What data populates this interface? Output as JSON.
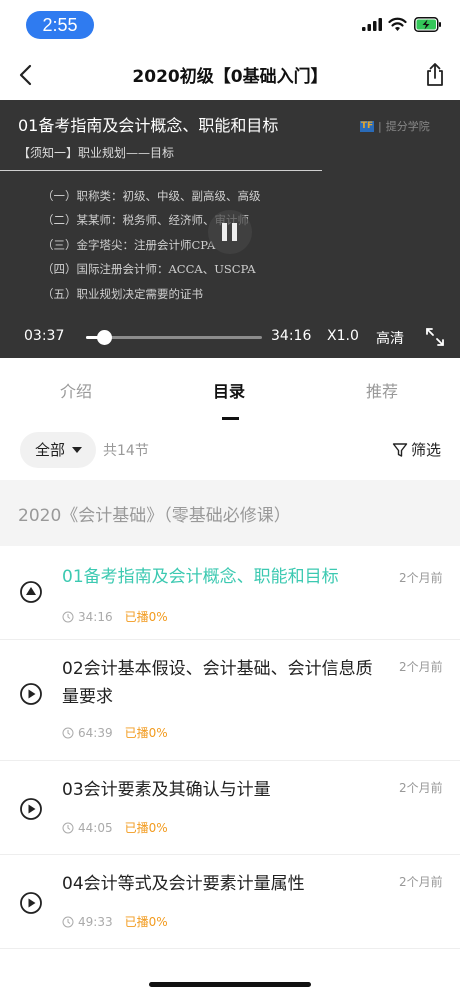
{
  "status_bar": {
    "time": "2:55"
  },
  "nav": {
    "title": "2020初级【0基础入门】"
  },
  "video": {
    "title": "01备考指南及会计概念、职能和目标",
    "brand": "提分学院",
    "brand_mark": "TF",
    "subtitle": "【须知一】职业规划——目标",
    "outline": [
      "（一）职称类：初级、中级、副高级、高级",
      "（二）某某师：税务师、经济师、审计师",
      "（三）金字塔尖：注册会计师CPA",
      "（四）国际注册会计师：ACCA、USCPA",
      "（五）职业规划决定需要的证书"
    ],
    "current_time": "03:37",
    "total_time": "34:16",
    "progress": 0.1055,
    "speed": "X1.0",
    "quality": "高清"
  },
  "tabs": [
    {
      "label": "介绍",
      "active": false
    },
    {
      "label": "目录",
      "active": true
    },
    {
      "label": "推荐",
      "active": false
    }
  ],
  "filter": {
    "scope_label": "全部",
    "count_text": "共14节",
    "filter_label": "筛选"
  },
  "section": {
    "title": "2020《会计基础》（零基础必修课）"
  },
  "lessons": [
    {
      "title": "01备考指南及会计概念、职能和目标",
      "date": "2个月前",
      "duration": "34:16",
      "progress": "已播0%",
      "active": true
    },
    {
      "title": "02会计基本假设、会计基础、会计信息质量要求",
      "date": "2个月前",
      "duration": "64:39",
      "progress": "已播0%",
      "active": false
    },
    {
      "title": "03会计要素及其确认与计量",
      "date": "2个月前",
      "duration": "44:05",
      "progress": "已播0%",
      "active": false
    },
    {
      "title": "04会计等式及会计要素计量属性",
      "date": "2个月前",
      "duration": "49:33",
      "progress": "已播0%",
      "active": false
    }
  ],
  "icons": {
    "status": [
      "signal-icon",
      "wifi-icon",
      "battery-charging-icon"
    ],
    "nav": [
      "back-icon",
      "share-icon"
    ],
    "player": [
      "pause-icon",
      "fullscreen-icon"
    ],
    "list": [
      "play-circle-icon",
      "clock-icon",
      "filter-funnel-icon",
      "caret-down-icon"
    ]
  },
  "colors": {
    "accent": "#3cc9b1",
    "progress_text": "#f29b1f",
    "status_time_bg": "#2f7bf0",
    "video_bg": "#353535"
  }
}
